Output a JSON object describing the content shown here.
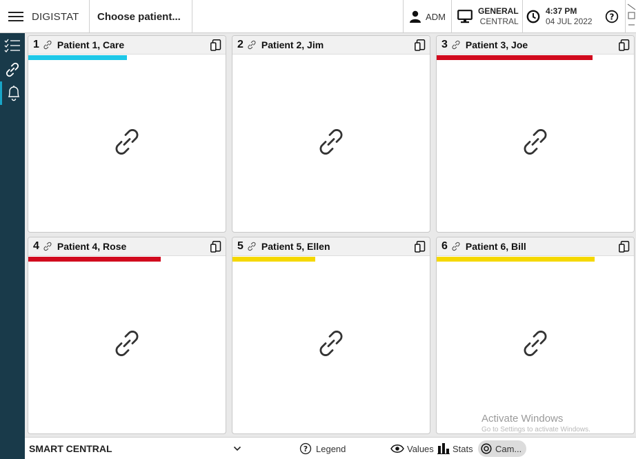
{
  "topbar": {
    "brand": "DIGISTAT",
    "choose_label": "Choose patient...",
    "user": "ADM",
    "workstation_line1": "GENERAL",
    "workstation_line2": "CENTRAL",
    "time": "4:37 PM",
    "date": "04 JUL 2022",
    "icons": [
      "hamburger-menu-icon",
      "user-icon",
      "monitor-icon",
      "clock-icon",
      "help-icon"
    ]
  },
  "sidebar": {
    "items": [
      {
        "icon": "checklist-icon",
        "active": false
      },
      {
        "icon": "link-icon",
        "active": false
      },
      {
        "icon": "bell-icon",
        "active": true
      }
    ]
  },
  "tiles": [
    {
      "num": "1",
      "name": "Patient 1, Care",
      "bar_color": "#1ec8e8",
      "bar_fraction": 0.5
    },
    {
      "num": "2",
      "name": "Patient 2, Jim",
      "bar_color": "",
      "bar_fraction": 0
    },
    {
      "num": "3",
      "name": "Patient 3, Joe",
      "bar_color": "#d10a1e",
      "bar_fraction": 0.79
    },
    {
      "num": "4",
      "name": "Patient 4, Rose",
      "bar_color": "#d10a1e",
      "bar_fraction": 0.67
    },
    {
      "num": "5",
      "name": "Patient 5, Ellen",
      "bar_color": "#f5d800",
      "bar_fraction": 0.42
    },
    {
      "num": "6",
      "name": "Patient 6, Bill",
      "bar_color": "#f5d800",
      "bar_fraction": 0.8
    }
  ],
  "bottombar": {
    "module": "SMART CENTRAL",
    "legend": "Legend",
    "values": "Values",
    "stats": "Stats",
    "camera": "Cam..."
  },
  "watermark": {
    "line1": "Activate Windows",
    "line2": "Go to Settings to activate Windows."
  }
}
